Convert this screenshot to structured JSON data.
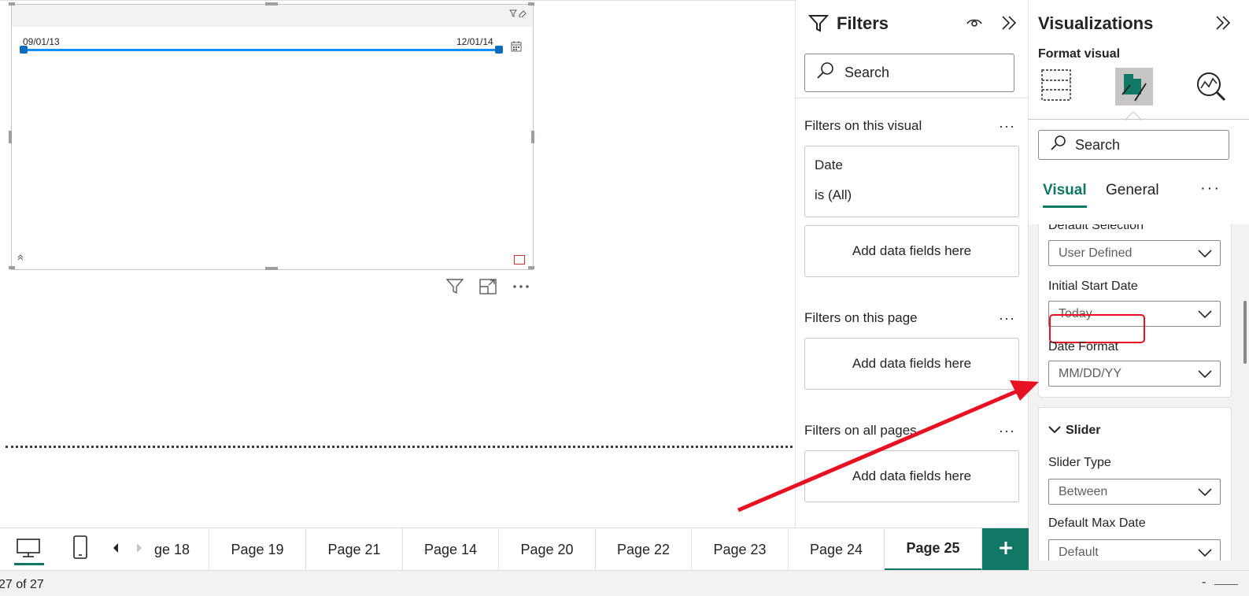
{
  "slicer": {
    "start_date": "09/01/13",
    "end_date": "12/01/14"
  },
  "filters": {
    "title": "Filters",
    "search_placeholder": "Search",
    "on_visual_label": "Filters on this visual",
    "date_field": "Date",
    "date_condition": "is (All)",
    "add_fields": "Add data fields here",
    "on_page_label": "Filters on this page",
    "on_all_pages_label": "Filters on all pages",
    "more": "···"
  },
  "viz": {
    "title": "Visualizations",
    "subtitle": "Format visual",
    "search_placeholder": "Search",
    "tab_visual": "Visual",
    "tab_general": "General",
    "more": "···",
    "default_selection_label": "Default Selection",
    "default_selection_value": "User Defined",
    "initial_start_label": "Initial Start Date",
    "initial_start_value": "Today",
    "date_format_label": "Date Format",
    "date_format_value": "MM/DD/YY",
    "slider_section": "Slider",
    "slider_type_label": "Slider Type",
    "slider_type_value": "Between",
    "default_max_label": "Default Max Date",
    "default_max_value": "Default"
  },
  "pages": {
    "first_partial": "ge 18",
    "tabs": [
      "Page 19",
      "Page 21",
      "Page 14",
      "Page 20",
      "Page 22",
      "Page 23",
      "Page 24",
      "Page 25"
    ],
    "active": "Page 25"
  },
  "status": {
    "page_count": "27 of 27",
    "zoom_minus": "-"
  },
  "colors": {
    "accent": "#117865",
    "slider_blue": "#118dff",
    "annotation_red": "#e81123"
  }
}
